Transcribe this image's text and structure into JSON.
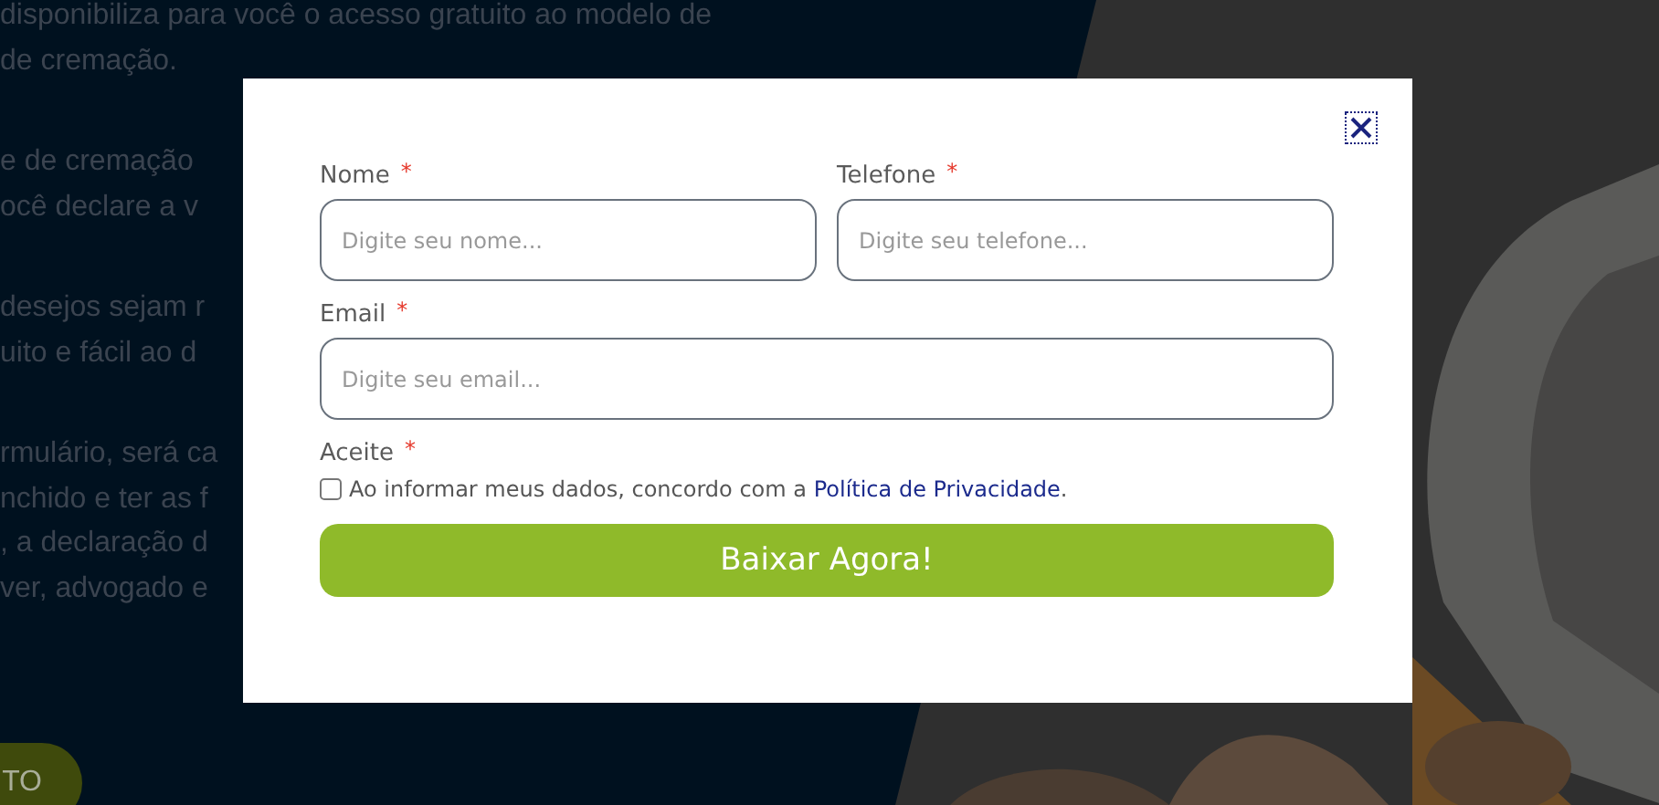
{
  "background": {
    "paragraphs": [
      [
        "disponibiliza para você o acesso gratuito ao modelo de",
        "de cremação."
      ],
      [
        "e de cremação",
        "ocê declare a v"
      ],
      [
        "desejos sejam r",
        "uito e fácil ao d"
      ],
      [
        "rmulário, será ca",
        "nchido e ter as f",
        ", a declaração d",
        "ver, advogado e"
      ]
    ],
    "button": "TO"
  },
  "modal": {
    "rows": [
      [
        {
          "label": "Nome",
          "required_mark": "*",
          "placeholder": "Digite seu nome..."
        },
        {
          "label": "Telefone",
          "required_mark": "*",
          "placeholder": "Digite seu telefone..."
        }
      ],
      [
        {
          "label": "Email",
          "required_mark": "*",
          "placeholder": "Digite seu email..."
        }
      ]
    ],
    "consent": {
      "label": "Aceite",
      "required_mark": "*",
      "checked": false,
      "text": "Ao informar meus dados, concordo com a ",
      "link": "Política de Privacidade",
      "suffix": "."
    },
    "submit": "Baixar Agora!"
  }
}
